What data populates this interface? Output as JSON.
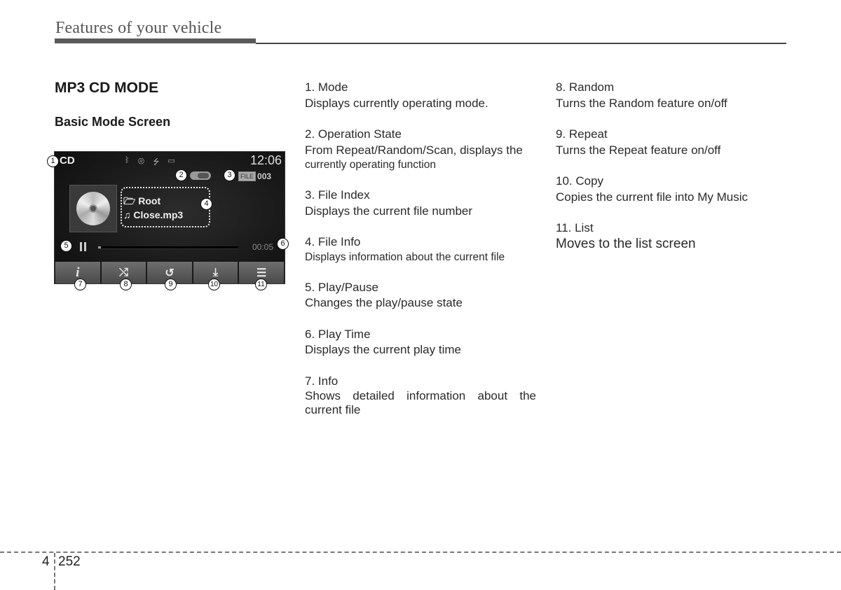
{
  "header": {
    "section_title": "Features of your vehicle"
  },
  "headings": {
    "main": "MP3 CD MODE",
    "sub": "Basic Mode Screen"
  },
  "screen": {
    "mode": "CD",
    "clock": "12:06",
    "status_icons": [
      "bluetooth-icon",
      "disc-icon",
      "usb-icon",
      "aux-icon"
    ],
    "file_label": "FILE",
    "file_number": "003",
    "folder": "Root",
    "filename": "Close.mp3",
    "play_time": "00:05",
    "progress_fraction": 0.02,
    "buttons": [
      {
        "name": "info",
        "glyph": "i"
      },
      {
        "name": "random",
        "glyph": "⤭"
      },
      {
        "name": "repeat",
        "glyph": "↺"
      },
      {
        "name": "copy",
        "glyph": "⤓"
      },
      {
        "name": "list",
        "glyph": "☰"
      }
    ]
  },
  "callouts": [
    "1",
    "2",
    "3",
    "4",
    "5",
    "6",
    "7",
    "8",
    "9",
    "10",
    "11"
  ],
  "items_col1": [
    {
      "title": "1. Mode",
      "desc": "Displays currently operating mode."
    },
    {
      "title": "2. Operation State",
      "desc": "From Repeat/Random/Scan, displays the",
      "desc2": "currently operating function"
    },
    {
      "title": "3. File Index",
      "desc": "Displays the current file number"
    },
    {
      "title": "4. File Info",
      "desc": "Displays information about the current file"
    },
    {
      "title": "5. Play/Pause",
      "desc": "Changes the play/pause state"
    },
    {
      "title": "6. Play Time",
      "desc": "Displays the current play time"
    },
    {
      "title": "7. Info",
      "desc": "Shows detailed information about the current file"
    }
  ],
  "items_col2": [
    {
      "title": "8. Random",
      "desc": "Turns the Random feature on/off"
    },
    {
      "title": "9. Repeat",
      "desc": "Turns the Repeat feature on/off"
    },
    {
      "title": "10. Copy",
      "desc": "Copies the current file into My Music"
    },
    {
      "title": "11. List",
      "desc": "Moves to the list screen"
    }
  ],
  "footer": {
    "chapter": "4",
    "page": "252"
  }
}
